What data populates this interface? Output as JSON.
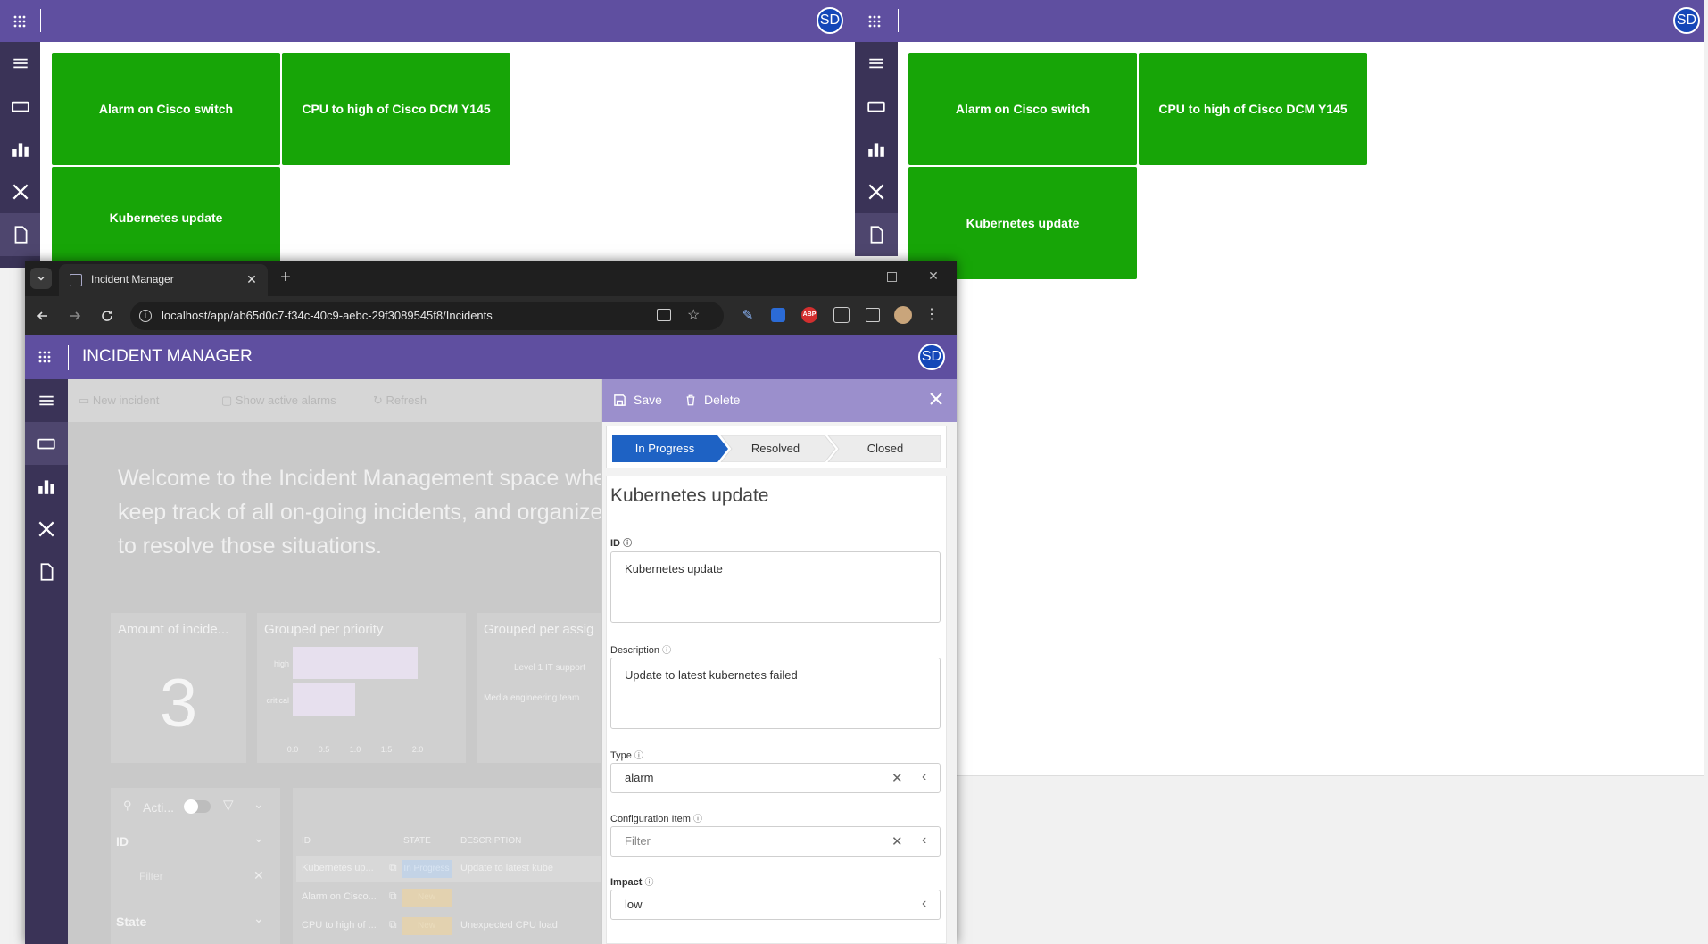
{
  "bg_left": {
    "avatar": "SD",
    "tiles": [
      "Alarm on Cisco switch",
      "CPU to high of Cisco DCM Y145",
      "Kubernetes update"
    ]
  },
  "bg_right": {
    "avatar": "SD",
    "tiles": [
      "Alarm on Cisco switch",
      "CPU to high of Cisco DCM Y145",
      "Kubernetes update"
    ]
  },
  "browser": {
    "tab_title": "Incident Manager",
    "url": "localhost/app/ab65d0c7-f34c-40c9-aebc-29f3089545f8/Incidents"
  },
  "app": {
    "title": "INCIDENT MANAGER",
    "avatar": "SD",
    "toolbar": {
      "new_incident": "New incident",
      "show_active_alarms": "Show active alarms",
      "refresh": "Refresh"
    },
    "welcome": "Welcome to the Incident Management space where you can keep track of all on-going incidents, and organize our activities to resolve those situations.",
    "cards": {
      "amount_title": "Amount of incide...",
      "amount_value": "3",
      "priority_title": "Grouped per priority",
      "priority_bars": [
        {
          "label": "high",
          "value": 2.0
        },
        {
          "label": "critical",
          "value": 1.0
        }
      ],
      "priority_ticks": [
        "0.0",
        "0.5",
        "1.0",
        "1.5",
        "2.0"
      ],
      "assignee_title": "Grouped per assig",
      "assignee_labels": [
        "Level 1 IT support",
        "Media engineering team"
      ]
    },
    "filter_panel": {
      "search_label": "Acti...",
      "id_label": "ID",
      "filter_placeholder": "Filter",
      "state_label": "State"
    },
    "table": {
      "headers": [
        "ID",
        "STATE",
        "DESCRIPTION"
      ],
      "rows": [
        {
          "id": "Kubernetes up...",
          "state": "In Progress",
          "description": "Update to latest kube"
        },
        {
          "id": "Alarm on Cisco...",
          "state": "New",
          "description": ""
        },
        {
          "id": "CPU to high of ...",
          "state": "New",
          "description": "Unexpected CPU load"
        }
      ]
    }
  },
  "detail": {
    "save_label": "Save",
    "delete_label": "Delete",
    "steps": [
      "In Progress",
      "Resolved",
      "Closed"
    ],
    "heading": "Kubernetes update",
    "id_label": "ID",
    "id_value": "Kubernetes update",
    "description_label": "Description",
    "description_value": "Update to latest kubernetes failed",
    "type_label": "Type",
    "type_value": "alarm",
    "ci_label": "Configuration Item",
    "ci_placeholder": "Filter",
    "impact_label": "Impact",
    "impact_value": "low"
  }
}
